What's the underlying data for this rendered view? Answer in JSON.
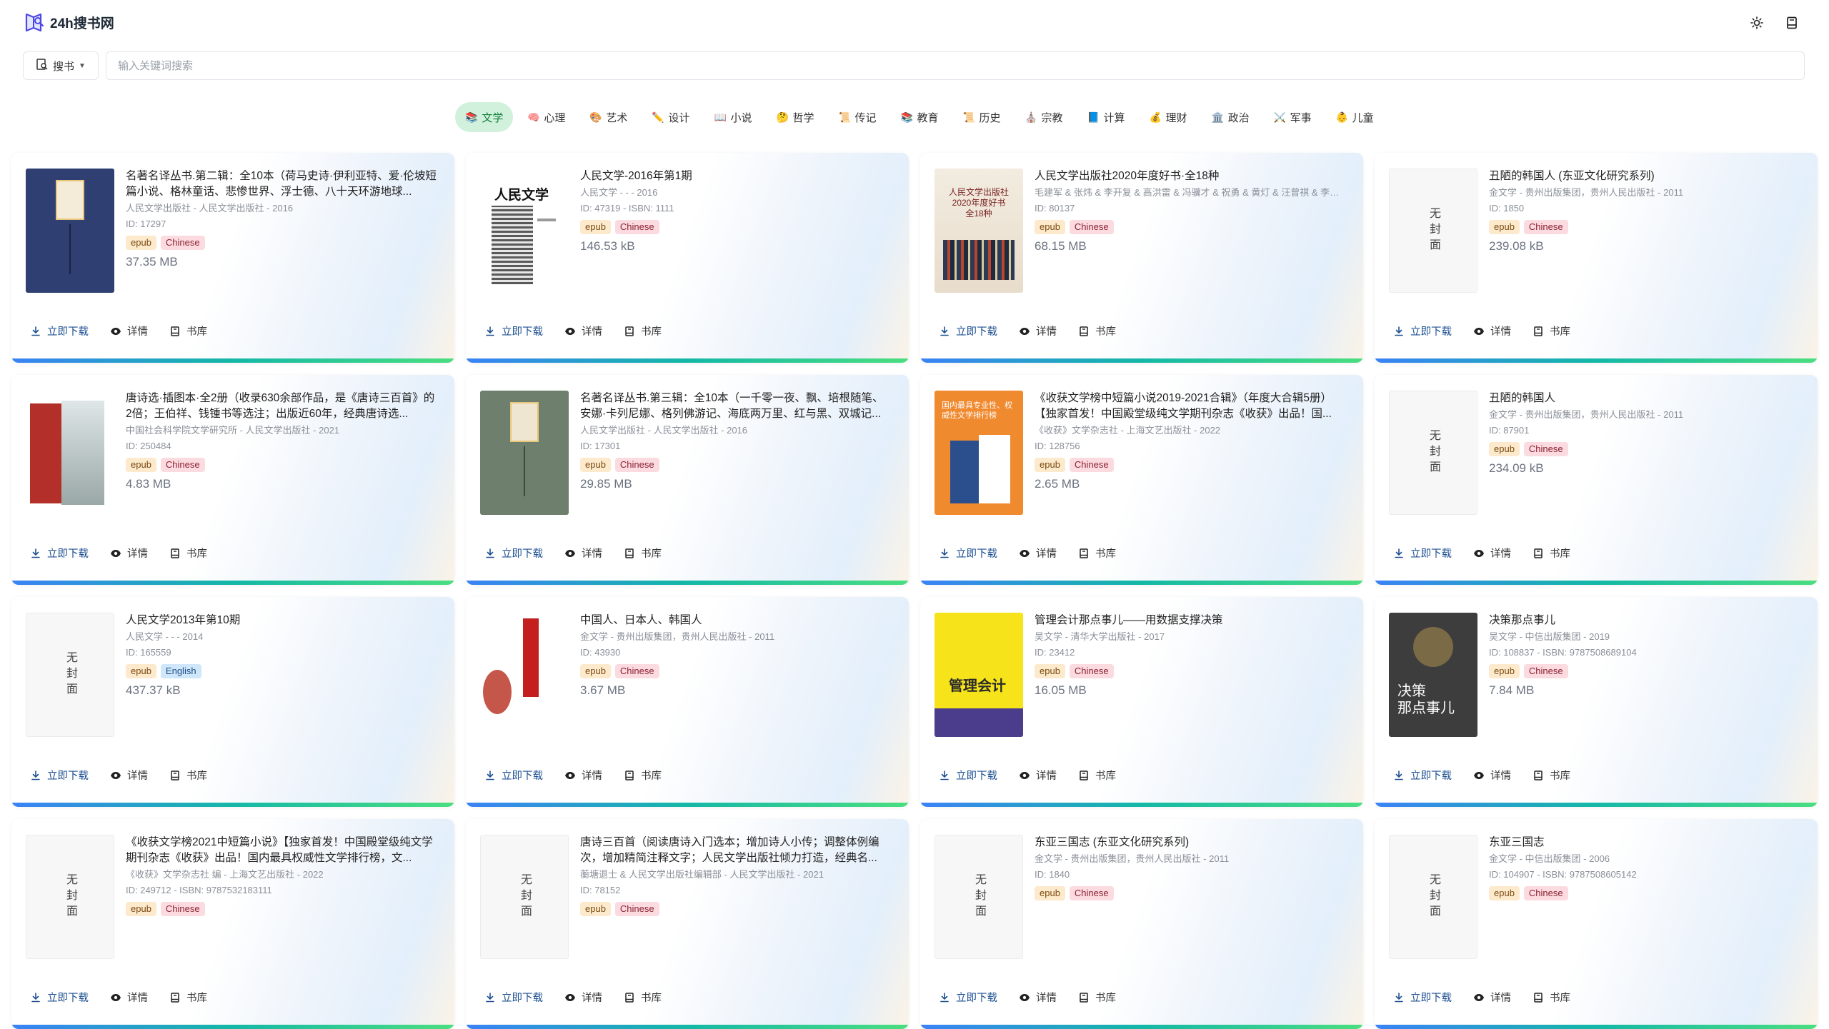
{
  "app": {
    "logo_text": "24h搜书网"
  },
  "search": {
    "mode_label": "搜书",
    "placeholder": "输入关键词搜索"
  },
  "categories": [
    {
      "icon": "📚",
      "label": "文学",
      "active": true
    },
    {
      "icon": "🧠",
      "label": "心理"
    },
    {
      "icon": "🎨",
      "label": "艺术"
    },
    {
      "icon": "✏️",
      "label": "设计"
    },
    {
      "icon": "📖",
      "label": "小说"
    },
    {
      "icon": "🤔",
      "label": "哲学"
    },
    {
      "icon": "📜",
      "label": "传记"
    },
    {
      "icon": "📚",
      "label": "教育"
    },
    {
      "icon": "📜",
      "label": "历史"
    },
    {
      "icon": "⛪",
      "label": "宗教"
    },
    {
      "icon": "📘",
      "label": "计算"
    },
    {
      "icon": "💰",
      "label": "理财"
    },
    {
      "icon": "🏛️",
      "label": "政治"
    },
    {
      "icon": "⚔️",
      "label": "军事"
    },
    {
      "icon": "👶",
      "label": "儿童"
    }
  ],
  "actions": {
    "download": "立即下载",
    "details": "详情",
    "library": "书库"
  },
  "no_cover_text": "无封面",
  "books": [
    {
      "title": "名著名译丛书.第二辑：全10本（荷马史诗·伊利亚特、爱·伦坡短篇小说、格林童话、悲惨世界、浮士德、八十天环游地球...",
      "meta": "人民文学出版社 - 人民文学出版社 - 2016",
      "id": "ID: 17297",
      "format": "epub",
      "lang": "Chinese",
      "size": "37.35 MB",
      "cover": "navy"
    },
    {
      "title": "人民文学-2016年第1期",
      "meta": "人民文学 - - - 2016",
      "id": "ID: 47319 - ISBN: 1111",
      "format": "epub",
      "lang": "Chinese",
      "size": "146.53 kB",
      "cover": "rmwx"
    },
    {
      "title": "人民文学出版社2020年度好书·全18种",
      "meta": "毛建军 & 张炜 & 李开复 & 高洪雷 & 冯骥才 & 祝勇 & 黄灯 & 汪曾祺 & 李子恺 & 焦波 & 徐贵祥 & 刘心武 & 邱华栋 & 李洁非 & 钱锺书 &...",
      "id": "ID: 80137",
      "format": "epub",
      "lang": "Chinese",
      "size": "68.15 MB",
      "cover": "books18"
    },
    {
      "title": "丑陋的韩国人 (东亚文化研究系列)",
      "meta": "金文学 - 贵州出版集团，贵州人民出版社 - 2011",
      "id": "ID: 1850",
      "format": "epub",
      "lang": "Chinese",
      "size": "239.08 kB",
      "cover": "none"
    },
    {
      "title": "唐诗选·插图本·全2册（收录630余部作品，是《唐诗三百首》的2倍；王伯祥、钱锺书等选注；出版近60年，经典唐诗选...",
      "meta": "中国社会科学院文学研究所 - 人民文学出版社 - 2021",
      "id": "ID: 250484",
      "format": "epub",
      "lang": "Chinese",
      "size": "4.83 MB",
      "cover": "tangshi"
    },
    {
      "title": "名著名译丛书.第三辑：全10本（一千零一夜、飘、培根随笔、安娜·卡列尼娜、格列佛游记、海底两万里、红与黑、双城记...",
      "meta": "人民文学出版社 - 人民文学出版社 - 2016",
      "id": "ID: 17301",
      "format": "epub",
      "lang": "Chinese",
      "size": "29.85 MB",
      "cover": "green"
    },
    {
      "title": "《收获文学榜中短篇小说2019-2021合辑》（年度大合辑5册）【独家首发！中国殿堂级纯文学期刊杂志《收获》出品！国...",
      "meta": "《收获》文学杂志社 - 上海文艺出版社 - 2022",
      "id": "ID: 128756",
      "format": "epub",
      "lang": "Chinese",
      "size": "2.65 MB",
      "cover": "orange"
    },
    {
      "title": "丑陋的韩国人",
      "meta": "金文学 - 贵州出版集团，贵州人民出版社 - 2011",
      "id": "ID: 87901",
      "format": "epub",
      "lang": "Chinese",
      "size": "234.09 kB",
      "cover": "none"
    },
    {
      "title": "人民文学2013年第10期",
      "meta": "人民文学 - - - 2014",
      "id": "ID: 165559",
      "format": "epub",
      "lang": "English",
      "size": "437.37 kB",
      "cover": "none"
    },
    {
      "title": "中国人、日本人、韩国人",
      "meta": "金文学 - 贵州出版集团，贵州人民出版社 - 2011",
      "id": "ID: 43930",
      "format": "epub",
      "lang": "Chinese",
      "size": "3.67 MB",
      "cover": "masks"
    },
    {
      "title": "管理会计那点事儿——用数据支撑决策",
      "meta": "吴文学 - 清华大学出版社 - 2017",
      "id": "ID: 23412",
      "format": "epub",
      "lang": "Chinese",
      "size": "16.05 MB",
      "cover": "yellow"
    },
    {
      "title": "决策那点事儿",
      "meta": "吴文学 - 中信出版集团 - 2019",
      "id": "ID: 108837 - ISBN: 9787508689104",
      "format": "epub",
      "lang": "Chinese",
      "size": "7.84 MB",
      "cover": "dark"
    },
    {
      "title": "《收获文学榜2021中短篇小说》【独家首发！中国殿堂级纯文学期刊杂志《收获》出品！国内最具权威性文学排行榜，文...",
      "meta": "《收获》文学杂志社 编 - 上海文艺出版社 - 2022",
      "id": "ID: 249712 - ISBN: 9787532183111",
      "format": "epub",
      "lang": "Chinese",
      "size": "",
      "cover": "none"
    },
    {
      "title": "唐诗三百首（阅读唐诗入门选本；增加诗人小传；调整体例编次，增加精简注释文字；人民文学出版社倾力打造，经典名...",
      "meta": "蘅塘退士 & 人民文学出版社编辑部 - 人民文学出版社 - 2021",
      "id": "ID: 78152",
      "format": "epub",
      "lang": "Chinese",
      "size": "",
      "cover": "none"
    },
    {
      "title": "东亚三国志 (东亚文化研究系列)",
      "meta": "金文学 - 贵州出版集团，贵州人民出版社 - 2011",
      "id": "ID: 1840",
      "format": "epub",
      "lang": "Chinese",
      "size": "",
      "cover": "none"
    },
    {
      "title": "东亚三国志",
      "meta": "金文学 - 中信出版集团 - 2006",
      "id": "ID: 104907 - ISBN: 9787508605142",
      "format": "epub",
      "lang": "Chinese",
      "size": "",
      "cover": "none"
    }
  ]
}
